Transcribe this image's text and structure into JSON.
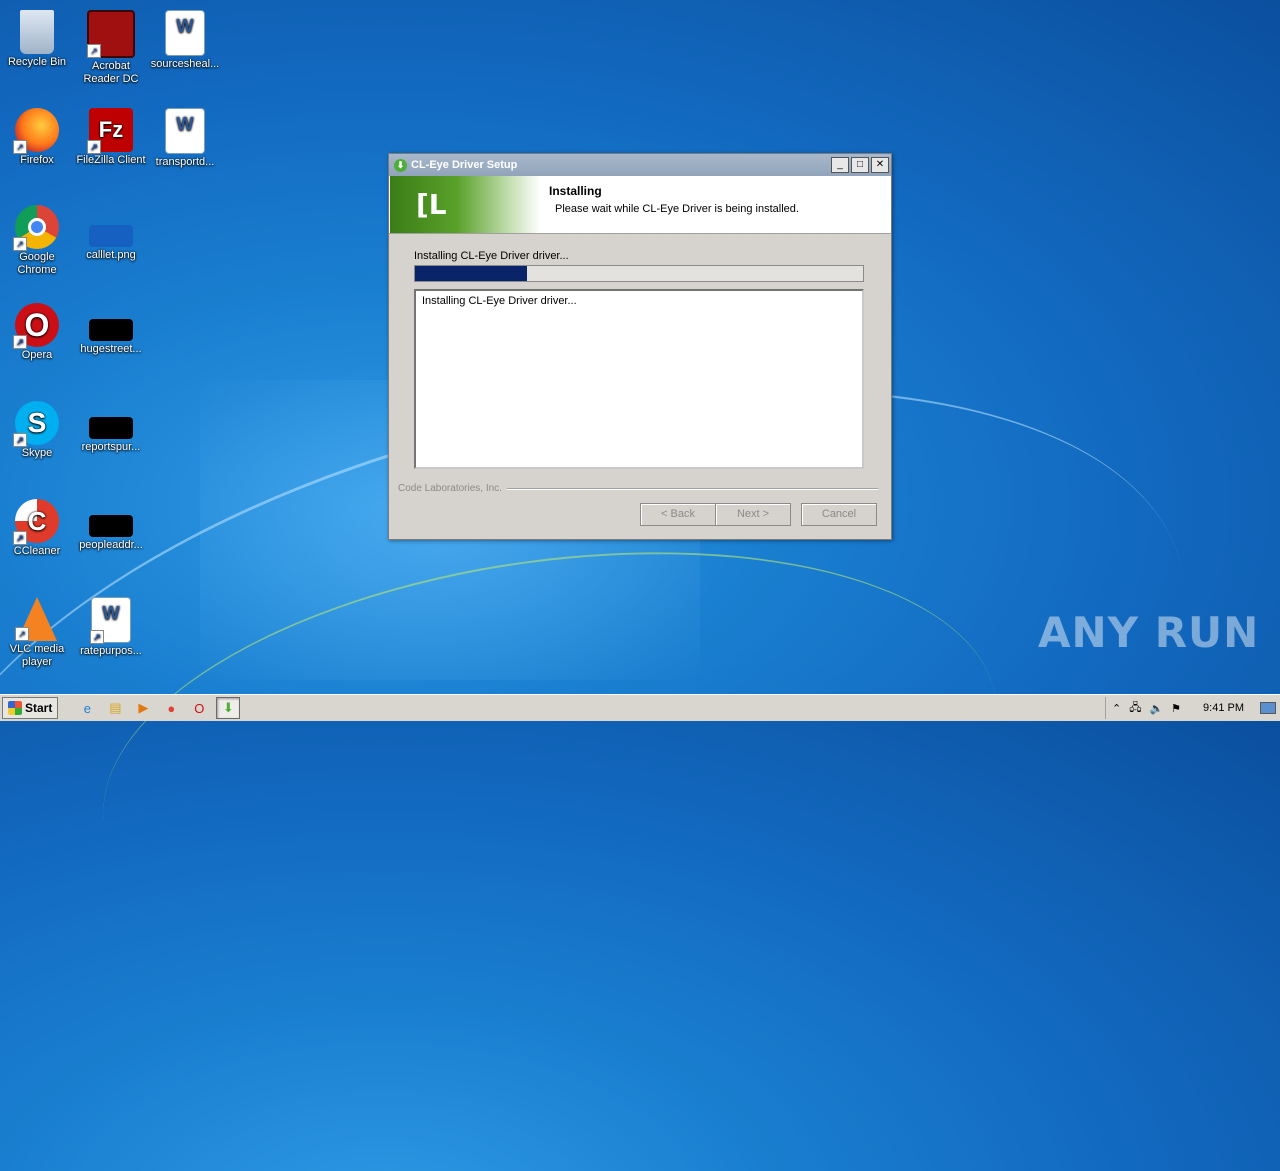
{
  "desktop": {
    "icons": [
      {
        "label": "Recycle Bin"
      },
      {
        "label": "Acrobat Reader DC"
      },
      {
        "label": "sourcesheal..."
      },
      {
        "label": "Firefox"
      },
      {
        "label": "FileZilla Client"
      },
      {
        "label": "transportd..."
      },
      {
        "label": "Google Chrome"
      },
      {
        "label": "calllet.png"
      },
      {
        "label": "Opera"
      },
      {
        "label": "hugestreet..."
      },
      {
        "label": "Skype"
      },
      {
        "label": "reportspur..."
      },
      {
        "label": "CCleaner"
      },
      {
        "label": "peopleaddr..."
      },
      {
        "label": "VLC media player"
      },
      {
        "label": "ratepurpos..."
      }
    ]
  },
  "window": {
    "title": "CL-Eye Driver Setup",
    "header_title": "Installing",
    "header_subtitle": "Please wait while CL-Eye Driver is being installed.",
    "logo_text": "[L",
    "status_label": "Installing CL-Eye Driver driver...",
    "progress": 0.25,
    "details_lines": [
      "Installing CL-Eye Driver driver..."
    ],
    "brand_text": "Code Laboratories, Inc.",
    "buttons": {
      "back": "< Back",
      "next": "Next >",
      "cancel": "Cancel"
    },
    "title_buttons": {
      "minimize": "_",
      "maximize": "□",
      "close": "✕"
    }
  },
  "taskbar": {
    "start_label": "Start",
    "clock": "9:41 PM"
  },
  "watermark": "ANY RUN"
}
